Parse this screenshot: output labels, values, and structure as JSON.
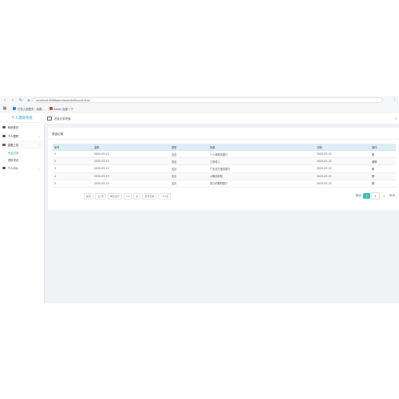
{
  "browser": {
    "url": "localhost:8088/pers/tools/toRecord.html",
    "bookmarks": [
      {
        "label": "已导入收藏夹 · 收藏..."
      },
      {
        "label": "baidu 百度一下"
      }
    ]
  },
  "sidebar": {
    "brand": "个人理财系统",
    "items": [
      {
        "label": "系统首页"
      },
      {
        "label": "个人理财"
      },
      {
        "label": "金融工具"
      }
    ],
    "subitems": [
      {
        "label": "资金记录"
      },
      {
        "label": "理财规划"
      }
    ],
    "last_item": {
      "label": "个人中心"
    }
  },
  "topbar": {
    "crumb": "资金记录界面",
    "right_icon": "ⓘ"
  },
  "card": {
    "title": "资金记录"
  },
  "table": {
    "headers": [
      "序号",
      "金额",
      "类型",
      "来源",
      "日期",
      "操作"
    ],
    "rows": [
      [
        "1",
        "2020-03-13",
        "支出",
        "个人转账到银行",
        "2020-03-15",
        "删"
      ],
      [
        "2",
        "2020-03-13",
        "支出",
        "工资收入",
        "2020-03-15",
        "编辑"
      ],
      [
        "3",
        "2020-03-13",
        "支出",
        "广告支付宝到银行",
        "2020-03-15",
        "删"
      ],
      [
        "4",
        "2020-03-13",
        "支出",
        "从微信转账",
        "2020-03-15",
        "删"
      ],
      [
        "5",
        "2020-03-13",
        "支出",
        "发行的理财银行",
        "2020-03-15",
        "删"
      ]
    ]
  },
  "pager_left": [
    "首页",
    "上1页",
    "每页显示",
    "5 ▾",
    "条",
    "总共记录",
    "- 1/2页"
  ],
  "pager_right": {
    "first": "首页",
    "pages": [
      "1",
      "2"
    ],
    "next": "»",
    "last": "末页"
  }
}
